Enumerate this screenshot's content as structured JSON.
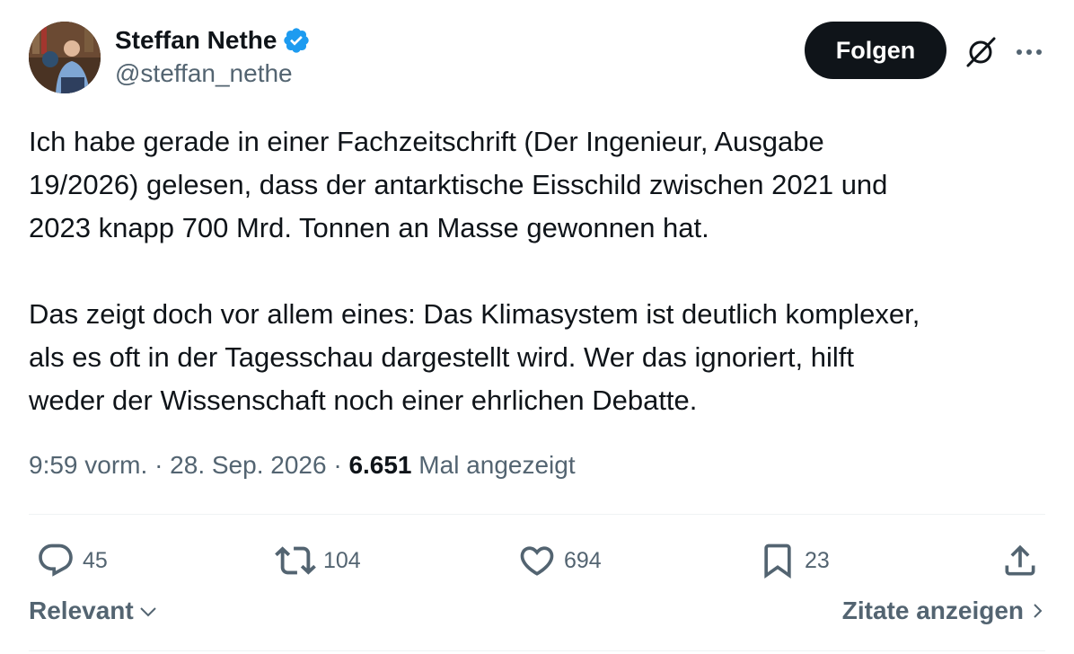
{
  "author": {
    "display_name": "Steffan Nethe",
    "handle": "@steffan_nethe",
    "verified": true
  },
  "header": {
    "follow_label": "Folgen"
  },
  "tweet": {
    "paragraphs": [
      [
        "Ich habe gerade in einer Fachzeitschrift (Der Ingenieur, Ausgabe",
        "19/2026) gelesen, dass der antarktische Eisschild zwischen 2021 und",
        "2023 knapp 700 Mrd. Tonnen an Masse gewonnen hat."
      ],
      [
        "Das zeigt doch vor allem eines: Das Klimasystem ist deutlich komplexer,",
        "als es oft in der Tagesschau dargestellt wird. Wer das ignoriert, hilft",
        "weder der Wissenschaft noch einer ehrlichen Debatte."
      ]
    ]
  },
  "meta": {
    "time": "9:59 vorm.",
    "separator": "·",
    "date": "28. Sep. 2026",
    "views_count": "6.651",
    "views_label": "Mal angezeigt"
  },
  "actions": {
    "replies": "45",
    "reposts": "104",
    "likes": "694",
    "bookmarks": "23"
  },
  "footer": {
    "sort_label": "Relevant",
    "quotes_label": "Zitate anzeigen"
  },
  "colors": {
    "text_primary": "#0f1419",
    "text_secondary": "#536471",
    "verified_blue": "#1d9bf0",
    "divider": "#eff3f4"
  },
  "icons": {
    "verified": "verified-badge-icon",
    "grok": "grok-icon",
    "more": "more-icon",
    "reply": "reply-icon",
    "repost": "repost-icon",
    "like": "heart-icon",
    "bookmark": "bookmark-icon",
    "share": "share-icon",
    "sort": "chevron-down-icon",
    "quotes": "chevron-right-icon"
  }
}
